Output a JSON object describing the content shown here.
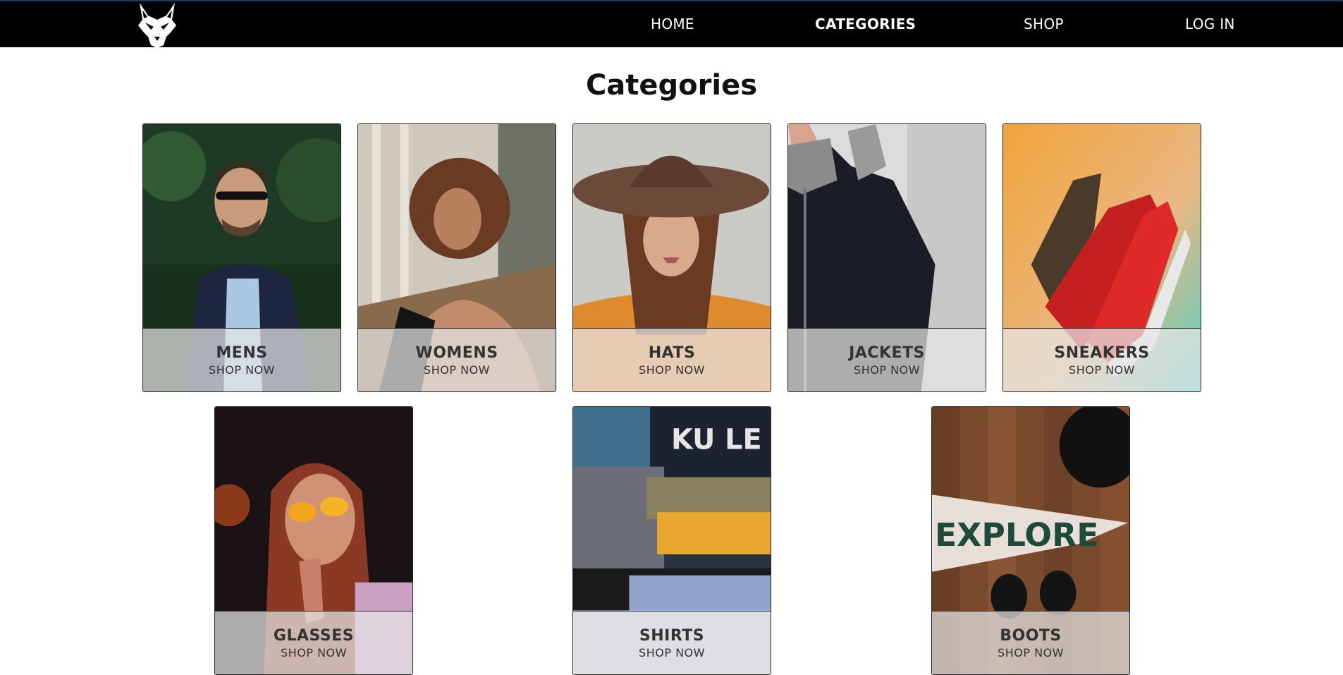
{
  "nav": {
    "logo_icon": "wolf-head-logo-icon",
    "links": [
      "HOME",
      "CATEGORIES",
      "SHOP",
      "LOG IN"
    ],
    "active": "CATEGORIES"
  },
  "page": {
    "title": "Categories"
  },
  "categories": [
    {
      "name": "MENS",
      "cta": "SHOP NOW"
    },
    {
      "name": "WOMENS",
      "cta": "SHOP NOW"
    },
    {
      "name": "HATS",
      "cta": "SHOP NOW"
    },
    {
      "name": "JACKETS",
      "cta": "SHOP NOW"
    },
    {
      "name": "SNEAKERS",
      "cta": "SHOP NOW"
    },
    {
      "name": "GLASSES",
      "cta": "SHOP NOW"
    },
    {
      "name": "SHIRTS",
      "cta": "SHOP NOW"
    },
    {
      "name": "BOOTS",
      "cta": "SHOP NOW"
    }
  ],
  "photo_texts": {
    "shirts_print": "KU LE",
    "boots_pennant": "EXPLORE"
  },
  "colors": {
    "navbar": "#000000",
    "nav_text": "#ffffff",
    "title": "#111111",
    "overlay": "#e6e6e6"
  }
}
